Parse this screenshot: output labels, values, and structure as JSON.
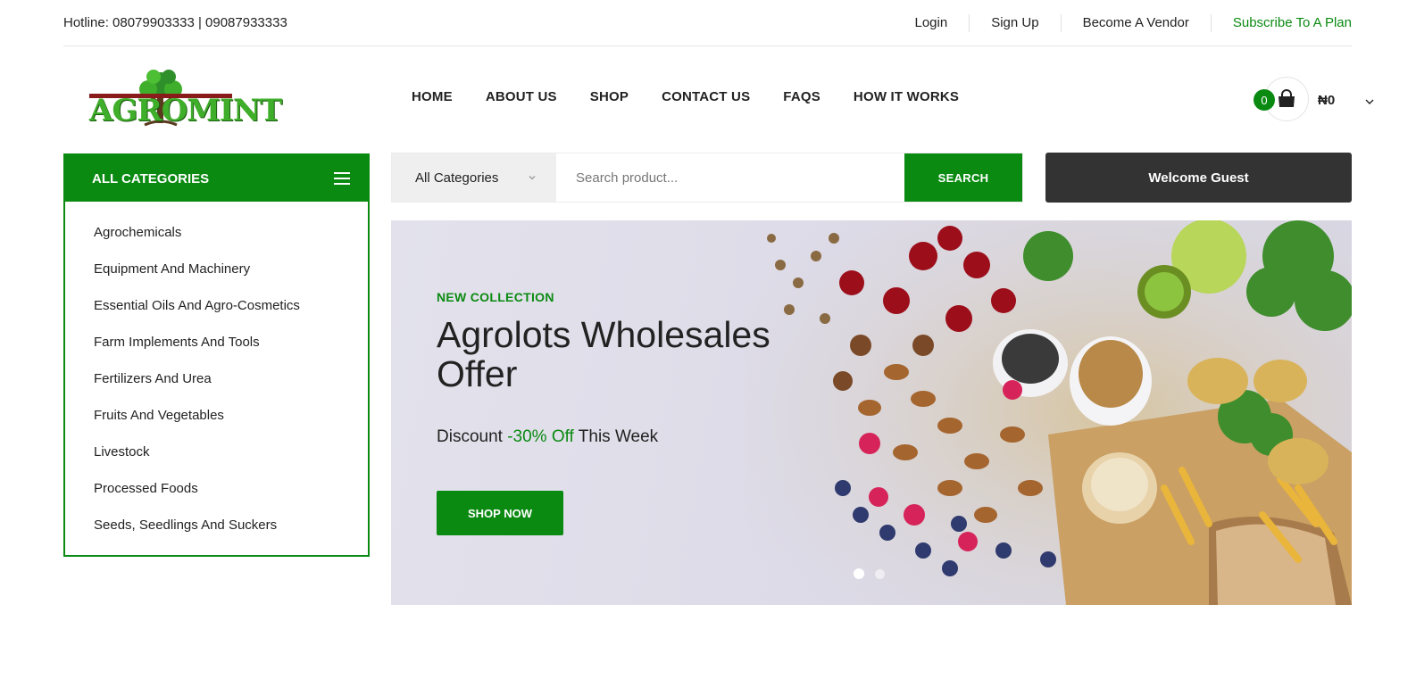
{
  "topbar": {
    "hotline": "Hotline: 08079903333 | 09087933333",
    "links": [
      {
        "label": "Login"
      },
      {
        "label": "Sign Up"
      },
      {
        "label": "Become A Vendor"
      },
      {
        "label": "Subscribe To A Plan",
        "color": "#0b8a12"
      }
    ]
  },
  "logo": {
    "text": "AGROMINT"
  },
  "nav": {
    "items": [
      "HOME",
      "ABOUT US",
      "SHOP",
      "CONTACT US",
      "FAQS",
      "HOW IT WORKS"
    ]
  },
  "cart": {
    "count": "0",
    "total": "₦0"
  },
  "categories": {
    "title": "ALL CATEGORIES",
    "items": [
      "Agrochemicals",
      "Equipment And Machinery",
      "Essential Oils And Agro-Cosmetics",
      "Farm Implements And Tools",
      "Fertilizers And Urea",
      "Fruits And Vegetables",
      "Livestock",
      "Processed Foods",
      "Seeds, Seedlings And Suckers"
    ]
  },
  "search": {
    "category_selected": "All Categories",
    "placeholder": "Search product...",
    "button_label": "SEARCH"
  },
  "welcome": {
    "label": "Welcome Guest"
  },
  "hero": {
    "eyebrow": "NEW COLLECTION",
    "title": "Agrolots Wholesales Offer",
    "sub_prefix": "Discount ",
    "sub_accent": "-30% Off",
    "sub_suffix": " This Week",
    "button_label": "SHOP NOW",
    "slides": 2,
    "active_slide": 1
  },
  "colors": {
    "accent": "#0b8a12",
    "dark": "#333333"
  }
}
